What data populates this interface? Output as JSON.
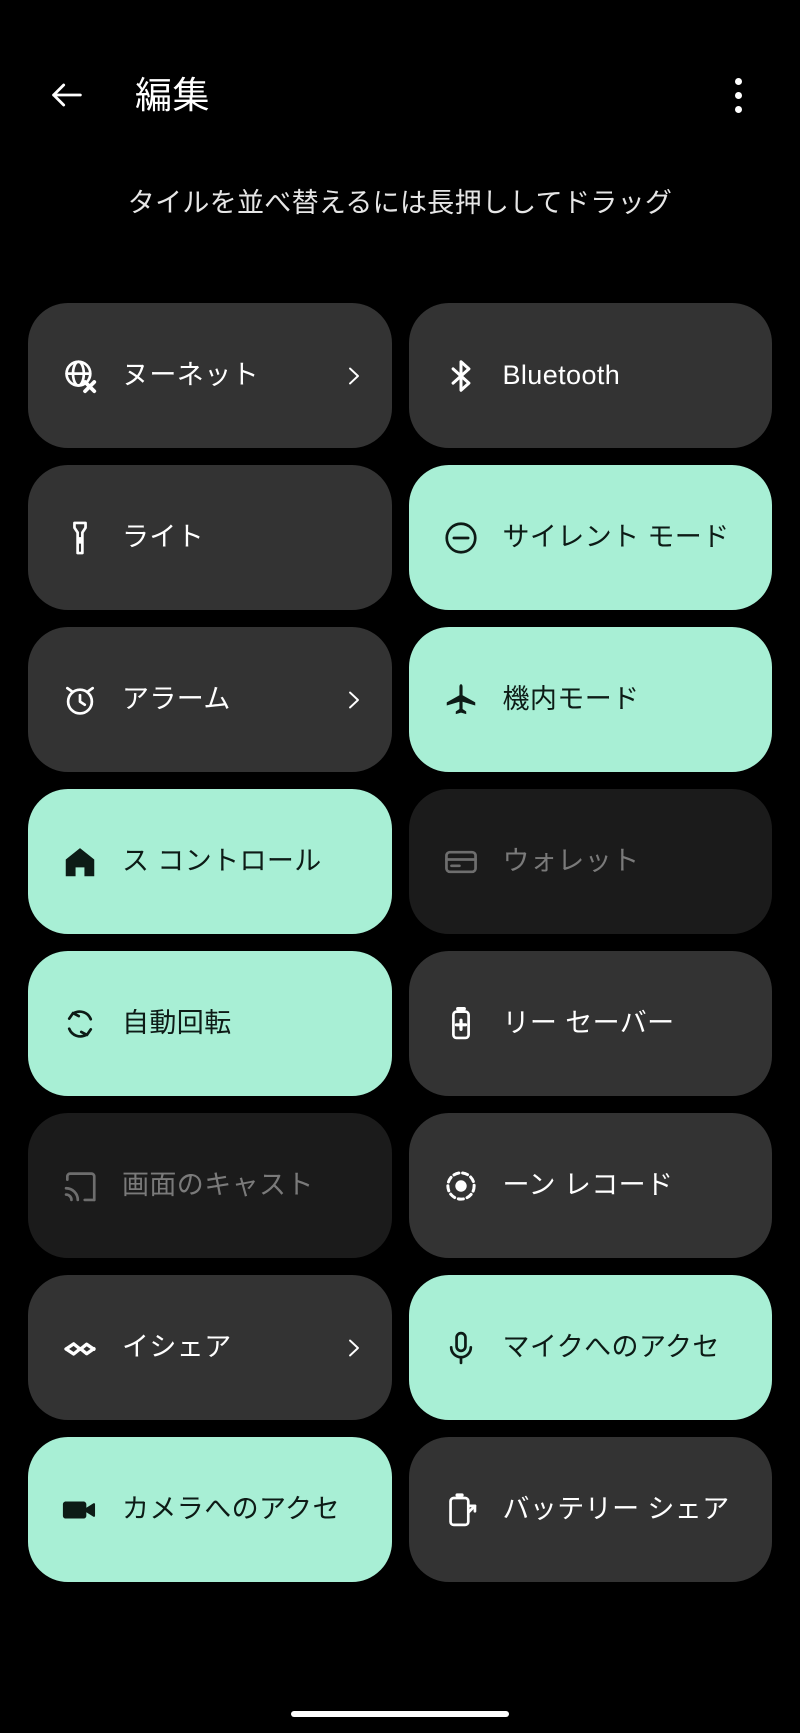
{
  "header": {
    "back_icon": "arrow-left-icon",
    "title": "編集",
    "overflow_icon": "more-vertical-icon"
  },
  "subtitle": "タイルを並べ替えるには長押ししてドラッグ",
  "colors": {
    "background": "#000000",
    "tile": "#333333",
    "tile_active": "#a8efd5",
    "tile_disabled": "#1b1b1b",
    "text": "#ffffff",
    "text_active": "#0d1b16",
    "text_disabled": "#7a7a7a"
  },
  "tiles": [
    {
      "label": "ヌーネット",
      "icon": "globe-off-icon",
      "state": "default",
      "chevron": true
    },
    {
      "label": "Bluetooth",
      "icon": "bluetooth-icon",
      "state": "default",
      "chevron": false
    },
    {
      "label": "ライト",
      "icon": "flashlight-icon",
      "state": "default",
      "chevron": false
    },
    {
      "label": "サイレント モード",
      "icon": "do-not-disturb-icon",
      "state": "active",
      "chevron": false
    },
    {
      "label": "アラーム",
      "icon": "alarm-icon",
      "state": "default",
      "chevron": true
    },
    {
      "label": "機内モード",
      "icon": "airplane-icon",
      "state": "active",
      "chevron": false
    },
    {
      "label": "ス コントロール",
      "icon": "home-icon",
      "state": "active",
      "chevron": false
    },
    {
      "label": "ウォレット",
      "icon": "wallet-icon",
      "state": "disabled",
      "chevron": false
    },
    {
      "label": "自動回転",
      "icon": "auto-rotate-icon",
      "state": "active",
      "chevron": false
    },
    {
      "label": "リー セーバー",
      "icon": "battery-saver-icon",
      "state": "default",
      "chevron": false
    },
    {
      "label": "画面のキャスト",
      "icon": "cast-icon",
      "state": "disabled",
      "chevron": false
    },
    {
      "label": "ーン レコード",
      "icon": "screen-record-icon",
      "state": "default",
      "chevron": false
    },
    {
      "label": "イシェア",
      "icon": "nearby-share-icon",
      "state": "default",
      "chevron": true
    },
    {
      "label": "マイクへのアクセ",
      "icon": "microphone-icon",
      "state": "active",
      "chevron": false
    },
    {
      "label": "カメラへのアクセ",
      "icon": "camera-icon",
      "state": "active",
      "chevron": false
    },
    {
      "label": "バッテリー シェア",
      "icon": "battery-share-icon",
      "state": "default",
      "chevron": false
    }
  ]
}
